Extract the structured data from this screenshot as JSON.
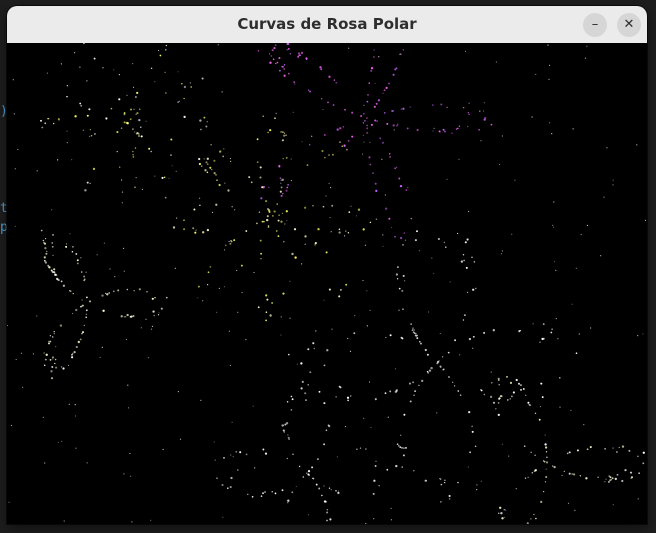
{
  "window": {
    "title": "Curvas de Rosa Polar",
    "minimize_icon": "minimize-icon",
    "close_icon": "close-icon",
    "minimize_glyph": "–",
    "close_glyph": "✕"
  },
  "background_window": {
    "text_fragments": [
      ")",
      "t",
      "p"
    ],
    "text_color": "#4ea1d3"
  },
  "canvas": {
    "background": "#000000",
    "palette": [
      "#ff66ff",
      "#ffff66",
      "#ffffff",
      "#cc66ff",
      "#ffffcc"
    ]
  }
}
